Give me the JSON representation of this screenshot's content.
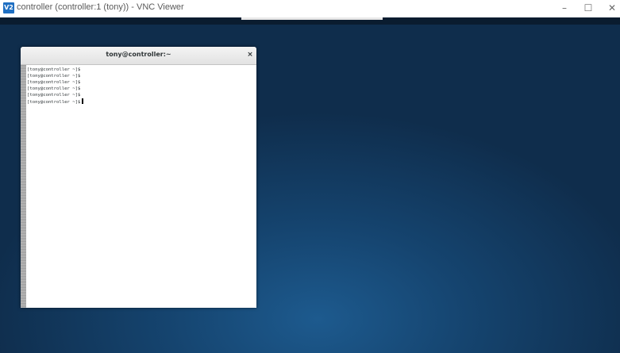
{
  "app": {
    "icon_label": "V2",
    "window_title": "controller (controller:1 (tony)) - VNC Viewer"
  },
  "window_controls": {
    "minimize": "–",
    "maximize": "☐",
    "close": "✕"
  },
  "terminal": {
    "title": "tony@controller:~",
    "close_glyph": "×",
    "lines": [
      "[tony@controller ~]$",
      "[tony@controller ~]$",
      "[tony@controller ~]$",
      "[tony@controller ~]$",
      "[tony@controller ~]$",
      "[tony@controller ~]$"
    ]
  },
  "colors": {
    "desktop_center": "#1d5a8e",
    "desktop_edge": "#0f2d4c",
    "app_icon": "#1f6fc2"
  }
}
